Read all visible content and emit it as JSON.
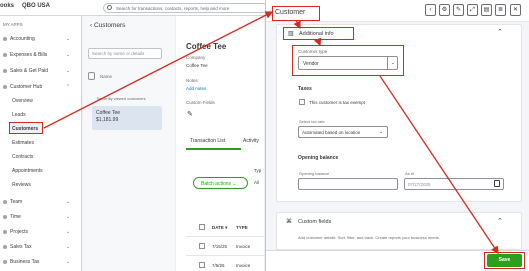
{
  "topbar": {
    "brand": "ooks",
    "company": "QBO USA",
    "search_placeholder": "Search for transactions, contacts, reports, help and more"
  },
  "sidebar": {
    "my_apps": "MY APPS",
    "items": [
      {
        "label": "Accounting",
        "chev": "⌄"
      },
      {
        "label": "Expenses & Bills",
        "chev": "⌄"
      },
      {
        "label": "Sales & Get Paid",
        "chev": "⌄"
      },
      {
        "label": "Customer Hub",
        "chev": "⌃"
      }
    ],
    "subitems": [
      "Overview",
      "Leads",
      "Customers",
      "Estimates",
      "Contracts",
      "Appointments",
      "Reviews"
    ],
    "more": [
      {
        "label": "Team",
        "chev": "⌄"
      },
      {
        "label": "Time",
        "chev": "⌄"
      },
      {
        "label": "Projects",
        "chev": "⌄"
      },
      {
        "label": "Sales Tax",
        "chev": "⌄"
      },
      {
        "label": "Business Tax",
        "chev": "⌄"
      }
    ]
  },
  "list": {
    "back_title": "‹ Customers",
    "search_placeholder": "Search by name or details",
    "sort_label": "Name",
    "recent_label": "Recently viewed customers",
    "recent_name": "Coffee Tee",
    "recent_amount": "$1,181.99"
  },
  "detail": {
    "name": "Coffee Tee",
    "company_label": "Company",
    "company_value": "Coffee Tee",
    "notes_label": "Notes",
    "add_notes": "Add notes",
    "custom_fields": "Custom Fields",
    "tab_transactions": "Transaction List",
    "tab_activity": "Activity",
    "type_short": "Typ",
    "all_short": "All",
    "batch": "Batch actions ⌄",
    "col_date": "DATE ▾",
    "col_type": "TYPE",
    "rows": [
      {
        "date": "7/15/25",
        "type": "Invoice"
      },
      {
        "date": "7/5/25",
        "type": "Invoice"
      }
    ]
  },
  "drawer": {
    "title": "Customer",
    "additional_info": "Additional info",
    "customer_type_label": "Customer type",
    "customer_type_value": "Vendor",
    "taxes": "Taxes",
    "tax_exempt": "This customer is tax exempt",
    "tax_rate_label": "Select tax rate",
    "tax_rate_value": "Automated based on location",
    "opening_balance": "Opening balance",
    "opening_balance_label": "Opening balance",
    "as_of_label": "As of",
    "as_of_value": "07/27/2025",
    "custom_fields": "Custom fields",
    "custom_fields_desc": "Add customer details. Sort, filter, and track. Create reports your business needs.",
    "save": "Save"
  },
  "colors": {
    "accent": "#2ca01c",
    "highlight": "#d52b1e"
  }
}
